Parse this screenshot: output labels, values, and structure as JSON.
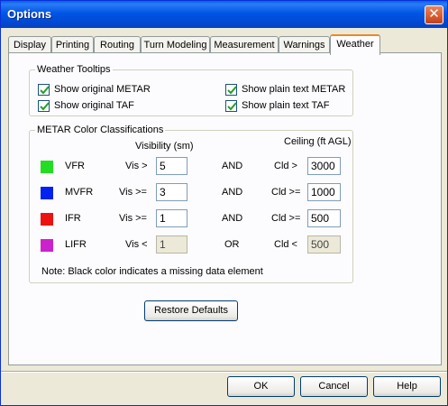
{
  "window": {
    "title": "Options"
  },
  "tabs": [
    "Display",
    "Printing",
    "Routing",
    "Turn Modeling",
    "Measurement",
    "Warnings",
    "Weather"
  ],
  "active_tab": "Weather",
  "tooltips": {
    "legend": "Weather Tooltips",
    "items": [
      {
        "label": "Show original METAR",
        "checked": true
      },
      {
        "label": "Show original TAF",
        "checked": true
      },
      {
        "label": "Show plain text METAR",
        "checked": true
      },
      {
        "label": "Show plain text TAF",
        "checked": true
      }
    ]
  },
  "metar": {
    "legend": "METAR Color Classifications",
    "visibility_header": "Visibility (sm)",
    "ceiling_header": "Ceiling (ft AGL)",
    "rows": [
      {
        "category": "VFR",
        "color": "#22dd22",
        "vis_op": "Vis >",
        "vis": "5",
        "logic": "AND",
        "cld_op": "Cld >",
        "cld": "3000",
        "editable": true
      },
      {
        "category": "MVFR",
        "color": "#0022ee",
        "vis_op": "Vis >=",
        "vis": "3",
        "logic": "AND",
        "cld_op": "Cld >=",
        "cld": "1000",
        "editable": true
      },
      {
        "category": "IFR",
        "color": "#ee1111",
        "vis_op": "Vis >=",
        "vis": "1",
        "logic": "AND",
        "cld_op": "Cld >=",
        "cld": "500",
        "editable": true
      },
      {
        "category": "LIFR",
        "color": "#cc22cc",
        "vis_op": "Vis <",
        "vis": "1",
        "logic": "OR",
        "cld_op": "Cld <",
        "cld": "500",
        "editable": false
      }
    ],
    "note": "Note: Black color indicates a missing data element"
  },
  "restore_label": "Restore Defaults",
  "buttons": {
    "ok": "OK",
    "cancel": "Cancel",
    "help": "Help"
  }
}
